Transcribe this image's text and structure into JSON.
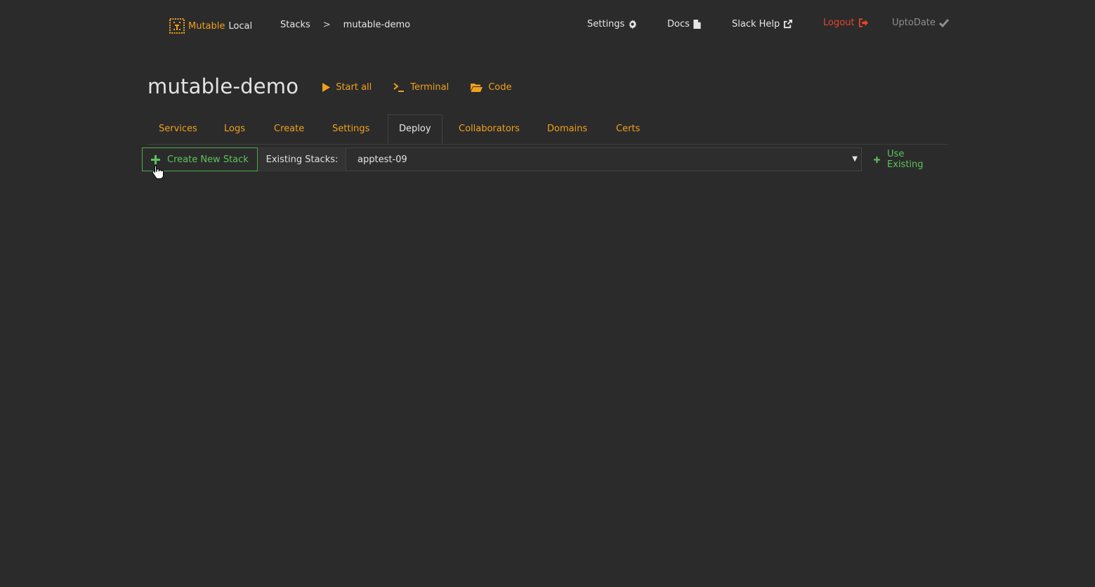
{
  "brand": {
    "name_accent": "Mutable",
    "name_rest": "Local"
  },
  "breadcrumb": {
    "stacks": "Stacks",
    "separator": ">",
    "current": "mutable-demo"
  },
  "topnav": {
    "settings": "Settings",
    "docs": "Docs",
    "slack_help": "Slack Help",
    "logout": "Logout",
    "status": "UptoDate"
  },
  "page": {
    "title": "mutable-demo",
    "actions": {
      "start_all": "Start all",
      "terminal": "Terminal",
      "code": "Code"
    }
  },
  "tabs": [
    {
      "label": "Services"
    },
    {
      "label": "Logs"
    },
    {
      "label": "Create"
    },
    {
      "label": "Settings"
    },
    {
      "label": "Deploy",
      "active": true
    },
    {
      "label": "Collaborators"
    },
    {
      "label": "Domains"
    },
    {
      "label": "Certs"
    }
  ],
  "deploy": {
    "create_new_stack": "Create New Stack",
    "existing_label": "Existing Stacks:",
    "selected_stack": "apptest-09",
    "use_existing": "Use Existing"
  },
  "colors": {
    "background": "#2b2b2b",
    "accent": "#f0a01c",
    "success": "#5cc35c",
    "danger": "#e8442e",
    "muted": "#8e8e8e"
  },
  "icons": {
    "brand": "mutable-logo-icon",
    "settings": "gear-icon",
    "docs": "document-icon",
    "slack": "external-link-icon",
    "logout": "sign-out-icon",
    "status": "check-icon",
    "start": "play-icon",
    "terminal": "terminal-icon",
    "code": "folder-open-icon",
    "plus": "plus-icon",
    "dropdown": "caret-down-icon"
  }
}
